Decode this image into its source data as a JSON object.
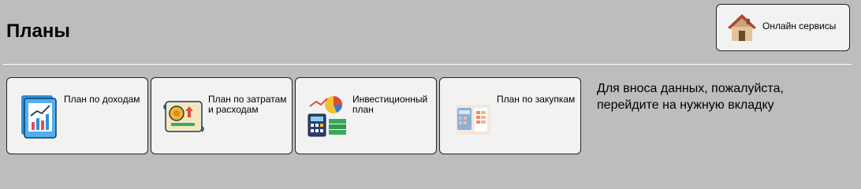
{
  "header": {
    "title": "Планы"
  },
  "online_services": {
    "label": "Онлайн сервисы",
    "icon": "house-icon"
  },
  "tiles": [
    {
      "label": "План по доходам",
      "icon": "income-chart-icon"
    },
    {
      "label": "План по затратам и расходам",
      "icon": "expenses-coin-icon"
    },
    {
      "label": "Инвестиционный план",
      "icon": "investment-calculator-icon"
    },
    {
      "label": "План по закупкам",
      "icon": "purchase-calculator-icon"
    }
  ],
  "info": {
    "line1": "Для вноса данных, пожалуйста,",
    "line2": "перейдите на нужную вкладку"
  }
}
